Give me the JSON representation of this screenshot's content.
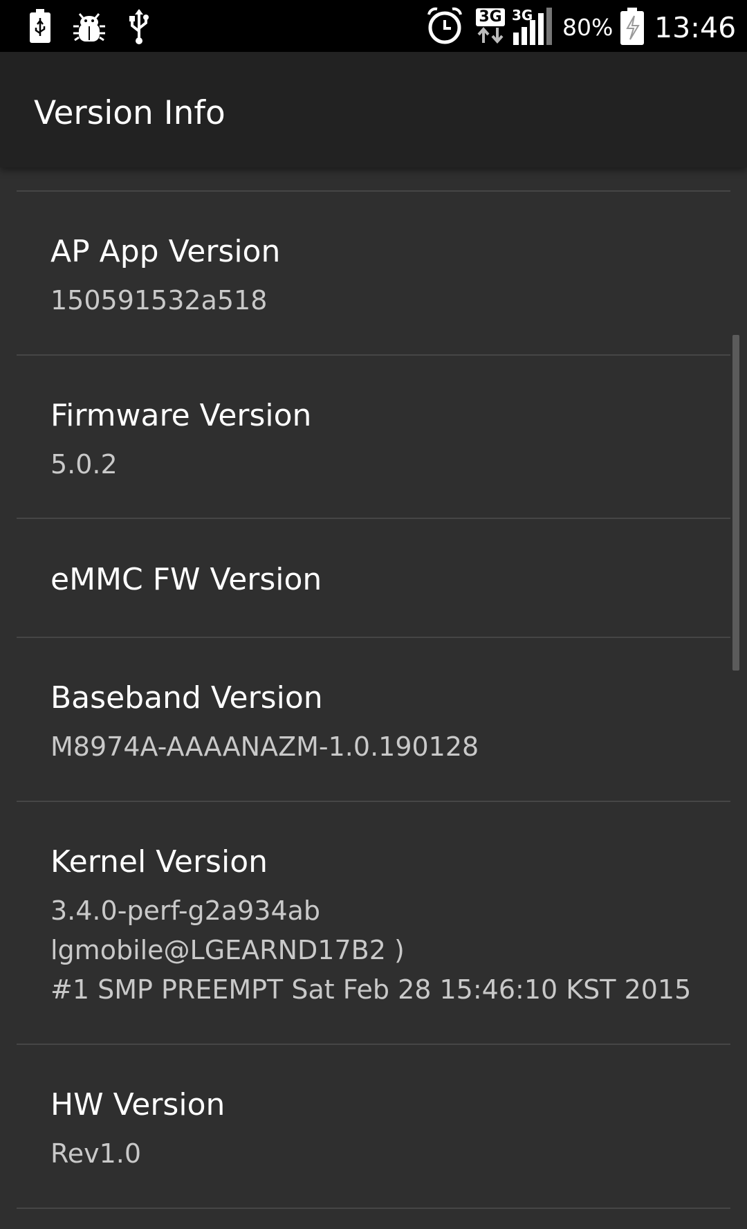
{
  "status_bar": {
    "icons": [
      "usb-debug-icon",
      "android-debug-icon",
      "usb-icon",
      "alarm-icon",
      "3g-data-icon",
      "signal-icon",
      "battery-charging-icon"
    ],
    "network_label_1": "3G",
    "network_label_2": "3G",
    "battery_percent": "80%",
    "time": "13:46"
  },
  "header": {
    "title": "Version Info"
  },
  "items": [
    {
      "title": "AP App Version",
      "value": "150591532a518"
    },
    {
      "title": "Firmware Version",
      "value": "5.0.2"
    },
    {
      "title": "eMMC FW Version",
      "value": ""
    },
    {
      "title": "Baseband Version",
      "value": "M8974A-AAAANAZM-1.0.190128"
    },
    {
      "title": "Kernel Version",
      "value_lines": [
        "3.4.0-perf-g2a934ab",
        "lgmobile@LGEARND17B2 )",
        "#1 SMP PREEMPT Sat Feb 28 15:46:10 KST 2015"
      ]
    },
    {
      "title": "HW Version",
      "value": "Rev1.0"
    }
  ]
}
